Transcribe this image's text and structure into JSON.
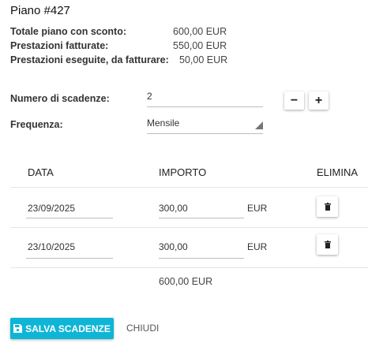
{
  "title": "Piano #427",
  "summary": [
    {
      "label": "Totale piano con sconto:",
      "value": "600,00 EUR"
    },
    {
      "label": "Prestazioni fatturate:",
      "value": "550,00 EUR"
    },
    {
      "label": "Prestazioni eseguite, da fatturare:",
      "value": "50,00 EUR"
    }
  ],
  "form": {
    "num_label": "Numero di scadenze:",
    "num_value": "2",
    "minus": "−",
    "plus": "+",
    "freq_label": "Frequenza:",
    "freq_value": "Mensile"
  },
  "table": {
    "headers": [
      "DATA",
      "IMPORTO",
      "ELIMINA"
    ],
    "rows": [
      {
        "date": "23/09/2025",
        "amount": "300,00",
        "currency": "EUR"
      },
      {
        "date": "23/10/2025",
        "amount": "300,00",
        "currency": "EUR"
      }
    ],
    "total": "600,00 EUR"
  },
  "actions": {
    "save_label": "SALVA SCADENZE",
    "close_label": "CHIUDI"
  },
  "icons": {
    "delete": "trash-icon",
    "save": "save-icon"
  },
  "colors": {
    "accent": "#0fb5d6"
  }
}
